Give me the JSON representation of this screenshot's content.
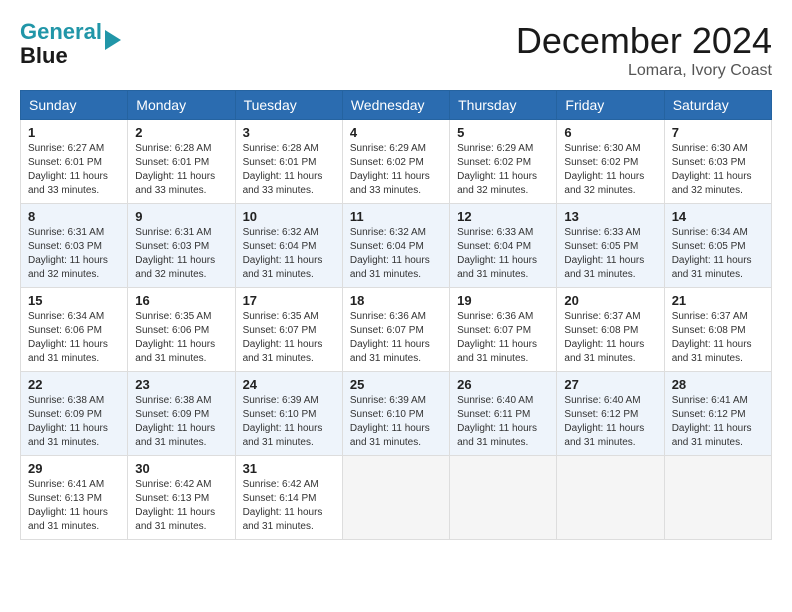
{
  "header": {
    "logo_line1": "General",
    "logo_line2": "Blue",
    "month_title": "December 2024",
    "location": "Lomara, Ivory Coast"
  },
  "days_of_week": [
    "Sunday",
    "Monday",
    "Tuesday",
    "Wednesday",
    "Thursday",
    "Friday",
    "Saturday"
  ],
  "weeks": [
    [
      {
        "day": "1",
        "info": "Sunrise: 6:27 AM\nSunset: 6:01 PM\nDaylight: 11 hours\nand 33 minutes."
      },
      {
        "day": "2",
        "info": "Sunrise: 6:28 AM\nSunset: 6:01 PM\nDaylight: 11 hours\nand 33 minutes."
      },
      {
        "day": "3",
        "info": "Sunrise: 6:28 AM\nSunset: 6:01 PM\nDaylight: 11 hours\nand 33 minutes."
      },
      {
        "day": "4",
        "info": "Sunrise: 6:29 AM\nSunset: 6:02 PM\nDaylight: 11 hours\nand 33 minutes."
      },
      {
        "day": "5",
        "info": "Sunrise: 6:29 AM\nSunset: 6:02 PM\nDaylight: 11 hours\nand 32 minutes."
      },
      {
        "day": "6",
        "info": "Sunrise: 6:30 AM\nSunset: 6:02 PM\nDaylight: 11 hours\nand 32 minutes."
      },
      {
        "day": "7",
        "info": "Sunrise: 6:30 AM\nSunset: 6:03 PM\nDaylight: 11 hours\nand 32 minutes."
      }
    ],
    [
      {
        "day": "8",
        "info": "Sunrise: 6:31 AM\nSunset: 6:03 PM\nDaylight: 11 hours\nand 32 minutes."
      },
      {
        "day": "9",
        "info": "Sunrise: 6:31 AM\nSunset: 6:03 PM\nDaylight: 11 hours\nand 32 minutes."
      },
      {
        "day": "10",
        "info": "Sunrise: 6:32 AM\nSunset: 6:04 PM\nDaylight: 11 hours\nand 31 minutes."
      },
      {
        "day": "11",
        "info": "Sunrise: 6:32 AM\nSunset: 6:04 PM\nDaylight: 11 hours\nand 31 minutes."
      },
      {
        "day": "12",
        "info": "Sunrise: 6:33 AM\nSunset: 6:04 PM\nDaylight: 11 hours\nand 31 minutes."
      },
      {
        "day": "13",
        "info": "Sunrise: 6:33 AM\nSunset: 6:05 PM\nDaylight: 11 hours\nand 31 minutes."
      },
      {
        "day": "14",
        "info": "Sunrise: 6:34 AM\nSunset: 6:05 PM\nDaylight: 11 hours\nand 31 minutes."
      }
    ],
    [
      {
        "day": "15",
        "info": "Sunrise: 6:34 AM\nSunset: 6:06 PM\nDaylight: 11 hours\nand 31 minutes."
      },
      {
        "day": "16",
        "info": "Sunrise: 6:35 AM\nSunset: 6:06 PM\nDaylight: 11 hours\nand 31 minutes."
      },
      {
        "day": "17",
        "info": "Sunrise: 6:35 AM\nSunset: 6:07 PM\nDaylight: 11 hours\nand 31 minutes."
      },
      {
        "day": "18",
        "info": "Sunrise: 6:36 AM\nSunset: 6:07 PM\nDaylight: 11 hours\nand 31 minutes."
      },
      {
        "day": "19",
        "info": "Sunrise: 6:36 AM\nSunset: 6:07 PM\nDaylight: 11 hours\nand 31 minutes."
      },
      {
        "day": "20",
        "info": "Sunrise: 6:37 AM\nSunset: 6:08 PM\nDaylight: 11 hours\nand 31 minutes."
      },
      {
        "day": "21",
        "info": "Sunrise: 6:37 AM\nSunset: 6:08 PM\nDaylight: 11 hours\nand 31 minutes."
      }
    ],
    [
      {
        "day": "22",
        "info": "Sunrise: 6:38 AM\nSunset: 6:09 PM\nDaylight: 11 hours\nand 31 minutes."
      },
      {
        "day": "23",
        "info": "Sunrise: 6:38 AM\nSunset: 6:09 PM\nDaylight: 11 hours\nand 31 minutes."
      },
      {
        "day": "24",
        "info": "Sunrise: 6:39 AM\nSunset: 6:10 PM\nDaylight: 11 hours\nand 31 minutes."
      },
      {
        "day": "25",
        "info": "Sunrise: 6:39 AM\nSunset: 6:10 PM\nDaylight: 11 hours\nand 31 minutes."
      },
      {
        "day": "26",
        "info": "Sunrise: 6:40 AM\nSunset: 6:11 PM\nDaylight: 11 hours\nand 31 minutes."
      },
      {
        "day": "27",
        "info": "Sunrise: 6:40 AM\nSunset: 6:12 PM\nDaylight: 11 hours\nand 31 minutes."
      },
      {
        "day": "28",
        "info": "Sunrise: 6:41 AM\nSunset: 6:12 PM\nDaylight: 11 hours\nand 31 minutes."
      }
    ],
    [
      {
        "day": "29",
        "info": "Sunrise: 6:41 AM\nSunset: 6:13 PM\nDaylight: 11 hours\nand 31 minutes."
      },
      {
        "day": "30",
        "info": "Sunrise: 6:42 AM\nSunset: 6:13 PM\nDaylight: 11 hours\nand 31 minutes."
      },
      {
        "day": "31",
        "info": "Sunrise: 6:42 AM\nSunset: 6:14 PM\nDaylight: 11 hours\nand 31 minutes."
      },
      {
        "day": "",
        "info": ""
      },
      {
        "day": "",
        "info": ""
      },
      {
        "day": "",
        "info": ""
      },
      {
        "day": "",
        "info": ""
      }
    ]
  ]
}
